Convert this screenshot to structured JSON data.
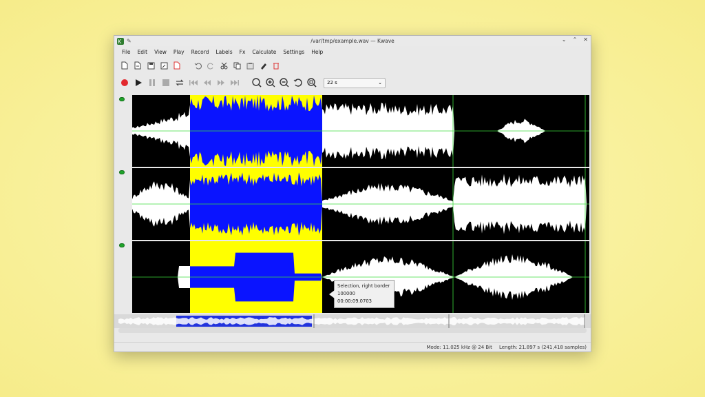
{
  "window": {
    "title": "/var/tmp/example.wav — Kwave",
    "controls": [
      "minimize-icon",
      "maximize-icon",
      "close-icon"
    ]
  },
  "menu": [
    "File",
    "Edit",
    "View",
    "Play",
    "Record",
    "Labels",
    "Fx",
    "Calculate",
    "Settings",
    "Help"
  ],
  "toolbar_file_edit": [
    "new-file-icon",
    "open-file-icon",
    "save-icon",
    "save-as-icon",
    "close-file-icon",
    "undo-icon",
    "redo-icon",
    "cut-icon",
    "copy-icon",
    "paste-icon",
    "erase-icon",
    "delete-icon"
  ],
  "toolbar_transport": [
    "record-icon",
    "play-icon",
    "pause-icon",
    "stop-icon",
    "loop-icon",
    "rewind-start-icon",
    "rewind-icon",
    "forward-icon",
    "forward-end-icon"
  ],
  "toolbar_zoom": [
    "zoom-to-selection-icon",
    "zoom-in-icon",
    "zoom-out-icon",
    "zoom-normal-icon",
    "zoom-all-icon"
  ],
  "zoom_select": {
    "value": "22 s"
  },
  "tooltip": {
    "line1": "Selection, right border",
    "line2": "100000",
    "line3": "00:00:09.0703"
  },
  "status": {
    "mode": "Mode: 11.025 kHz @ 24 Bit",
    "length": "Length: 21.897 s (241,418 samples)"
  },
  "colors": {
    "wave": "#ffffff",
    "wave_selected": "#0a14ff",
    "selection_bg": "#ffff00",
    "background": "#000000",
    "zero_line": "#3ddc3d"
  }
}
